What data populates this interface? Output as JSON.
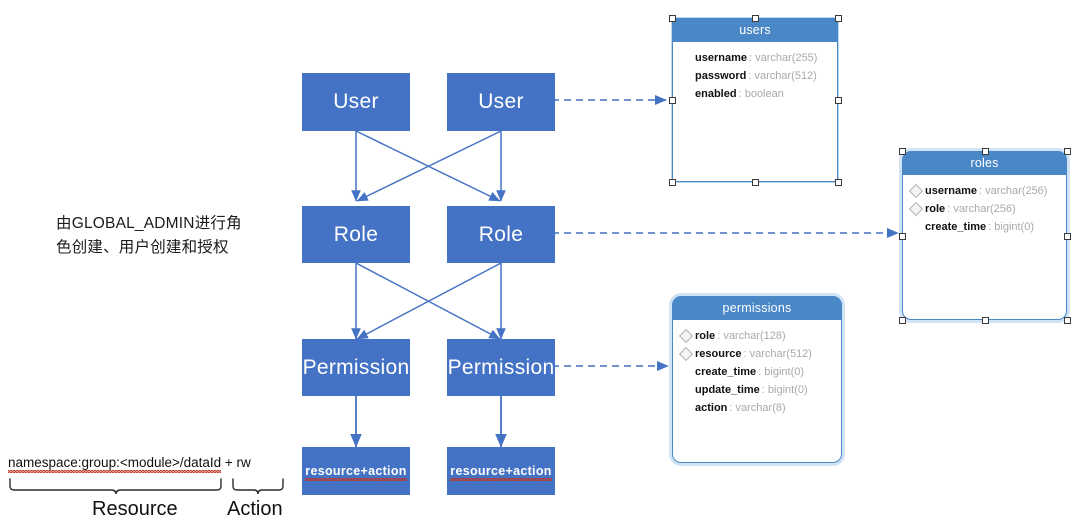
{
  "diagram": {
    "title_note": "由GLOBAL_ADMIN进行角\n色创建、用户创建和授权",
    "colors": {
      "box_fill": "#4472c4",
      "arrow": "#4472c4",
      "table_header": "#4a87c7",
      "table_border": "#4a87c7",
      "squiggle": "#c0392b",
      "field_name": "#111111",
      "field_type": "#a9a9a9"
    },
    "flow_columns": [
      {
        "nodes": [
          {
            "label": "User",
            "name": "user-box-left"
          },
          {
            "label": "Role",
            "name": "role-box-left"
          },
          {
            "label": "Permission",
            "name": "permission-box-left"
          },
          {
            "label": "resource+action",
            "name": "resource-action-box-left"
          }
        ]
      },
      {
        "nodes": [
          {
            "label": "User",
            "name": "user-box-right"
          },
          {
            "label": "Role",
            "name": "role-box-right"
          },
          {
            "label": "Permission",
            "name": "permission-box-right"
          },
          {
            "label": "resource+action",
            "name": "resource-action-box-right"
          }
        ]
      }
    ],
    "tables": [
      {
        "name": "users",
        "title": "users",
        "selected": true,
        "fields": [
          {
            "name": "username",
            "type": "varchar(255)",
            "pk": false
          },
          {
            "name": "password",
            "type": "varchar(512)",
            "pk": false
          },
          {
            "name": "enabled",
            "type": "boolean",
            "pk": false
          }
        ]
      },
      {
        "name": "roles",
        "title": "roles",
        "selected": true,
        "fields": [
          {
            "name": "username",
            "type": "varchar(256)",
            "pk": true
          },
          {
            "name": "role",
            "type": "varchar(256)",
            "pk": true
          },
          {
            "name": "create_time",
            "type": "bigint(0)",
            "pk": false
          }
        ]
      },
      {
        "name": "permissions",
        "title": "permissions",
        "selected": false,
        "fields": [
          {
            "name": "role",
            "type": "varchar(128)",
            "pk": true
          },
          {
            "name": "resource",
            "type": "varchar(512)",
            "pk": true
          },
          {
            "name": "create_time",
            "type": "bigint(0)",
            "pk": false
          },
          {
            "name": "update_time",
            "type": "bigint(0)",
            "pk": false
          },
          {
            "name": "action",
            "type": "varchar(8)",
            "pk": false
          }
        ]
      }
    ],
    "formula": {
      "expression": "namespace:group:<module>/dataId + rw",
      "resource_part": "namespace:group:<module>/dataId",
      "plus": " + ",
      "action_part": "rw",
      "resource_label": "Resource",
      "action_label": "Action"
    }
  }
}
